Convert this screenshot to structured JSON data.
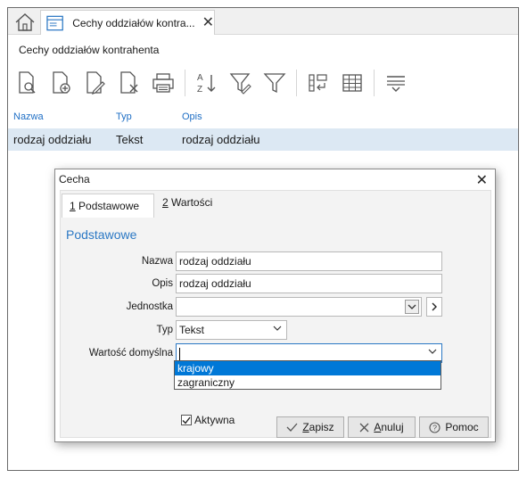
{
  "tab": {
    "label": "Cechy oddziałów kontra...",
    "close": "✕"
  },
  "page_title": "Cechy oddziałów kontrahenta",
  "toolbar": {
    "icons": [
      "preview-document-icon",
      "add-document-icon",
      "edit-document-icon",
      "delete-document-icon",
      "print-icon",
      "sort-az-icon",
      "filter-edit-icon",
      "filter-icon",
      "group-icon",
      "grid-icon",
      "options-icon"
    ],
    "sort_a": "A",
    "sort_z": "Z"
  },
  "grid": {
    "columns": [
      "Nazwa",
      "Typ",
      "Opis"
    ],
    "rows": [
      {
        "nazwa": "rodzaj oddziału",
        "typ": "Tekst",
        "opis": "rodzaj oddziału"
      }
    ]
  },
  "dialog": {
    "title": "Cecha",
    "close": "✕",
    "tabs": [
      {
        "key": "1",
        "rest": " Podstawowe"
      },
      {
        "key": "2",
        "rest": " Wartości"
      }
    ],
    "section": "Podstawowe",
    "labels": {
      "nazwa": "Nazwa",
      "opis": "Opis",
      "jednostka": "Jednostka",
      "typ": "Typ",
      "wartosc": "Wartość domyślna"
    },
    "values": {
      "nazwa": "rodzaj oddziału",
      "opis": "rodzaj oddziału",
      "jednostka": "",
      "typ": "Tekst",
      "wartosc": ""
    },
    "dropdown_options": [
      "krajowy",
      "zagraniczny"
    ],
    "selected_option_index": 0,
    "aktywna_label": "Aktywna",
    "aktywna_checked": true,
    "buttons": {
      "save": {
        "key": "Z",
        "rest": "apisz"
      },
      "cancel": {
        "key": "A",
        "rest": "nuluj"
      },
      "help": "Pomoc"
    }
  },
  "colors": {
    "accent": "#2b78c4",
    "selection": "#0078d7",
    "row_highlight": "#dce8f3"
  }
}
